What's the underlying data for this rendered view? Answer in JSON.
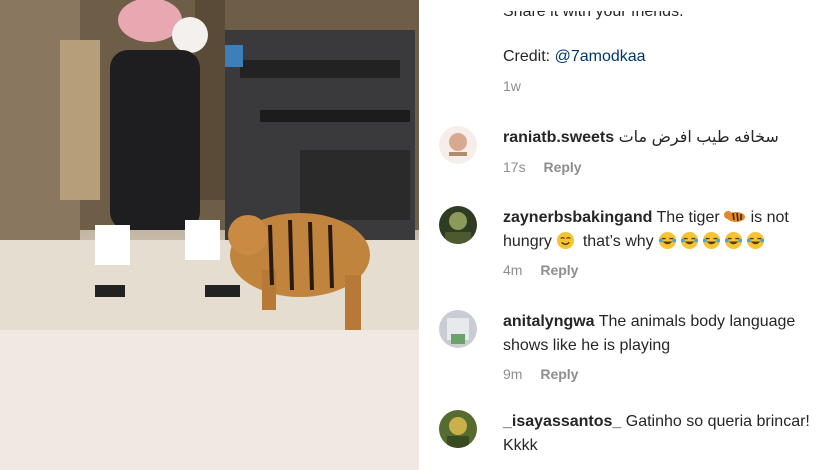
{
  "caption": {
    "partial_line": "Share it with your friends.",
    "credit_label": "Credit:",
    "credit_handle": "@7amodkaa",
    "time": "1w"
  },
  "comments": [
    {
      "username": "raniatb.sweets",
      "text": "سخافه طيب افرض مات",
      "time": "17s",
      "reply": "Reply",
      "avatar_color": "#f3e9e4"
    },
    {
      "username": "zaynerbsbakingand",
      "text_a": "The tiger",
      "emoji_tiger": "tiger-emoji",
      "text_b": "is not hungry",
      "emoji_smile": "smiling-face-emoji",
      "text_c": "that’s why",
      "emoji_laugh": "tears-of-joy-emoji",
      "time": "4m",
      "reply": "Reply",
      "avatar_color": "#3b4a2a"
    },
    {
      "username": "anitalyngwa",
      "text": "The animals body language shows like he is playing",
      "time": "9m",
      "reply": "Reply",
      "avatar_color": "#c9cdd3"
    },
    {
      "username": "_isayassantos_",
      "text": "Gatinho so queria brincar! Kkkk",
      "avatar_color": "#6a7a3a"
    }
  ]
}
